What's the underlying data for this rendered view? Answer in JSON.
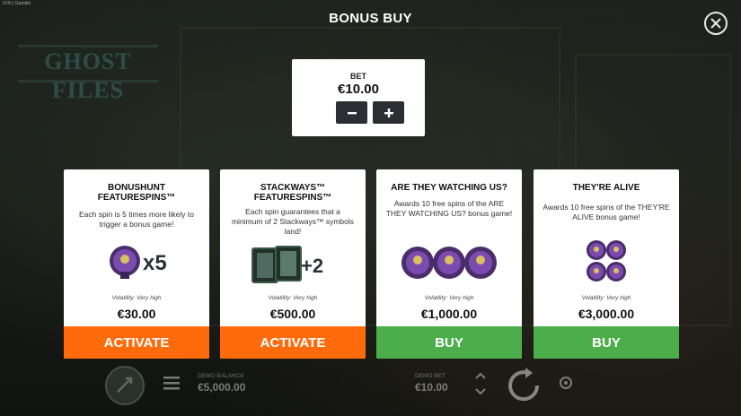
{
  "header": {
    "title": "BONUS BUY",
    "tiny_text": "0:00 | Gamble"
  },
  "bet": {
    "label": "BET",
    "value": "€10.00",
    "minus_label": "−",
    "plus_label": "+"
  },
  "cards": [
    {
      "title": "BONUSHUNT FEATURESPINS™",
      "description": "Each spin is 5 times more likely to trigger a bonus game!",
      "art_text": "x5",
      "volatility": "Volatility: Very high",
      "price": "€30.00",
      "button": "ACTIVATE",
      "button_color": "#ff6b0b"
    },
    {
      "title": "STACKWAYS™ FEATURESPINS™",
      "description": "Each spin guarantees that a minimum of 2 Stackways™ symbols land!",
      "art_text": "+2",
      "volatility": "Volatility: Very high",
      "price": "€500.00",
      "button": "ACTIVATE",
      "button_color": "#ff6b0b"
    },
    {
      "title": "ARE THEY WATCHING US?",
      "description": "Awards 10 free spins of the ARE THEY WATCHING US? bonus game!",
      "volatility": "Volatility: Very high",
      "price": "€1,000.00",
      "button": "BUY",
      "button_color": "#4cae4a"
    },
    {
      "title": "THEY'RE ALIVE",
      "description": "Awards 10 free spins of the THEY'RE ALIVE bonus game!",
      "volatility": "Volatility: Very high",
      "price": "€3,000.00",
      "button": "BUY",
      "button_color": "#4cae4a"
    }
  ],
  "bottom": {
    "balance_label": "DEMO BALANCE",
    "balance_value": "€5,000.00",
    "bet_label": "DEMO BET",
    "bet_value": "€10.00"
  },
  "background": {
    "logo_text": "GHOST FILES"
  },
  "colors": {
    "activate": "#ff6b0b",
    "buy": "#4cae4a",
    "symbol_purple": "#6a3fa0"
  }
}
